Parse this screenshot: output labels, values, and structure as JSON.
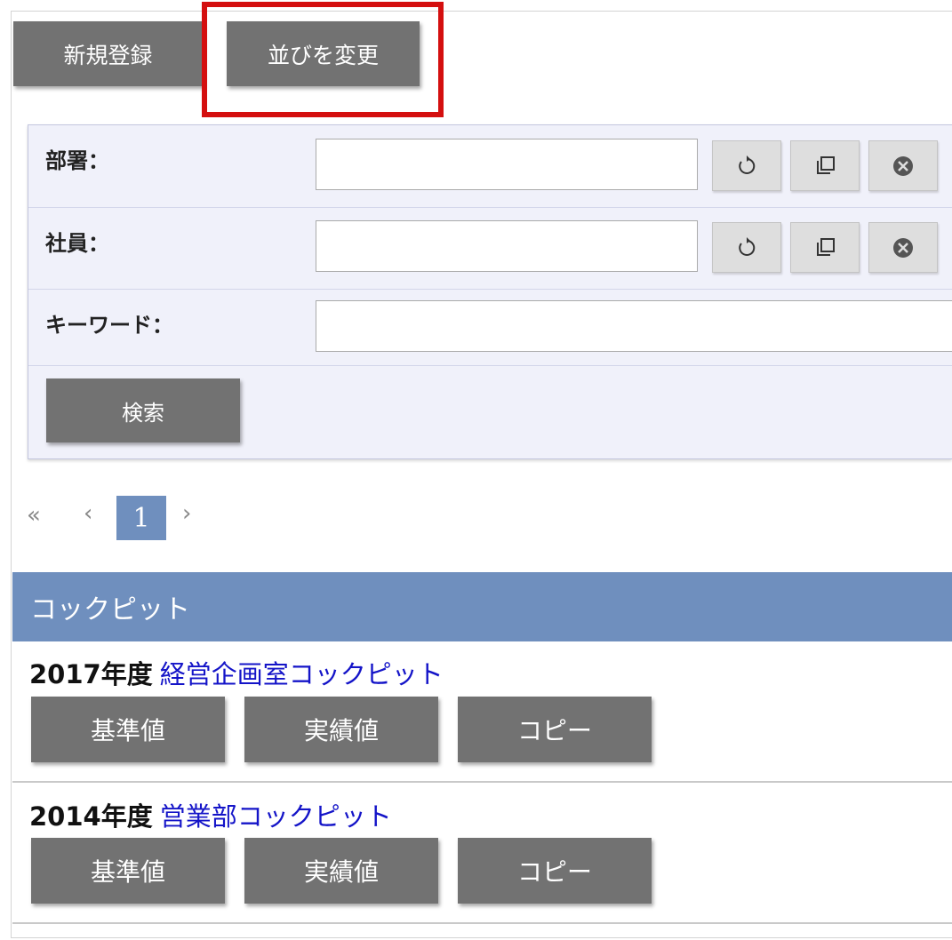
{
  "toolbar": {
    "new_label": "新規登録",
    "reorder_label": "並びを変更"
  },
  "search": {
    "department": {
      "label": "部署：",
      "value": ""
    },
    "employee": {
      "label": "社員：",
      "value": ""
    },
    "keyword": {
      "label": "キーワード：",
      "value": ""
    },
    "submit_label": "検索",
    "icons": [
      "reload-icon",
      "copy-icon",
      "clear-icon"
    ]
  },
  "pagination": {
    "first": "«",
    "prev": "‹",
    "current": "1",
    "next": "›"
  },
  "cockpit": {
    "header": "コックピット",
    "items": [
      {
        "year": "2017年度",
        "name": "経営企画室コックピット",
        "buttons": [
          "基準値",
          "実績値",
          "コピー"
        ]
      },
      {
        "year": "2014年度",
        "name": "営業部コックピット",
        "buttons": [
          "基準値",
          "実績値",
          "コピー"
        ]
      }
    ]
  },
  "colors": {
    "button_bg": "#727272",
    "header_bg": "#6f8fbe",
    "link": "#1414c8",
    "highlight": "#d40f0f",
    "panel_bg": "#f0f1fa"
  }
}
